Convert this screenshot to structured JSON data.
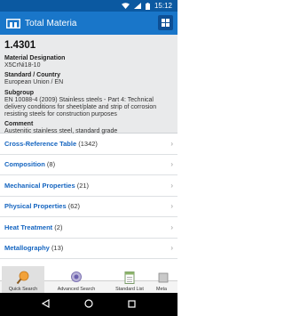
{
  "status": {
    "time": "15:12"
  },
  "app": {
    "title": "Total Materia"
  },
  "material": {
    "number": "1.4301",
    "fields": [
      {
        "label": "Material Designation",
        "value": "X5CrNi18-10"
      },
      {
        "label": "Standard / Country",
        "value": "European Union / EN"
      },
      {
        "label": "Subgroup",
        "value": "EN 10088-4 (2009) Stainless steels - Part 4: Technical delivery conditions for sheet/plate and strip of corrosion resisting steels for construction purposes"
      },
      {
        "label": "Comment",
        "value": "Austenitic stainless steel, standard grade"
      }
    ]
  },
  "sections": [
    {
      "label": "Cross-Reference Table",
      "count": "(1342)"
    },
    {
      "label": "Composition",
      "count": "(8)"
    },
    {
      "label": "Mechanical Properties",
      "count": "(21)"
    },
    {
      "label": "Physical Properties",
      "count": "(62)"
    },
    {
      "label": "Heat Treatment",
      "count": "(2)"
    },
    {
      "label": "Metallography",
      "count": "(13)"
    }
  ],
  "bottom_nav": [
    {
      "label": "Quick Search",
      "icon": "quick-search-icon",
      "active": true
    },
    {
      "label": "Advanced Search",
      "icon": "advanced-search-icon",
      "active": false
    },
    {
      "label": "Standard List",
      "icon": "standard-list-icon",
      "active": false
    },
    {
      "label": "Meta",
      "icon": "metals-icon",
      "active": false
    }
  ],
  "colors": {
    "status_bar": "#0b59a1",
    "app_bar": "#1976c9",
    "section_link": "#1565c0",
    "header_bg": "#e9eaeb"
  }
}
